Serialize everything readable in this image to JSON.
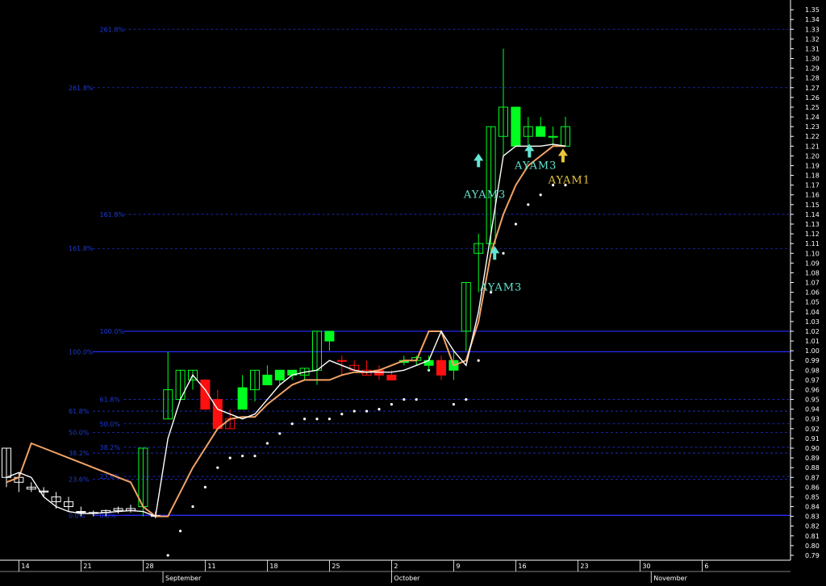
{
  "chart_data": {
    "type": "candlestick",
    "ylim": [
      0.785,
      1.36
    ],
    "y_ticks": [
      0.79,
      0.8,
      0.81,
      0.82,
      0.83,
      0.84,
      0.85,
      0.86,
      0.87,
      0.88,
      0.89,
      0.9,
      0.91,
      0.92,
      0.93,
      0.94,
      0.95,
      0.96,
      0.97,
      0.98,
      0.99,
      1.0,
      1.01,
      1.02,
      1.03,
      1.04,
      1.05,
      1.06,
      1.07,
      1.08,
      1.09,
      1.1,
      1.11,
      1.12,
      1.13,
      1.14,
      1.15,
      1.16,
      1.17,
      1.18,
      1.19,
      1.2,
      1.21,
      1.22,
      1.23,
      1.24,
      1.25,
      1.26,
      1.27,
      1.28,
      1.29,
      1.3,
      1.31,
      1.32,
      1.33,
      1.34,
      1.35
    ],
    "x_day_labels": [
      {
        "i": 1,
        "label": "14"
      },
      {
        "i": 6,
        "label": "21"
      },
      {
        "i": 11,
        "label": "28"
      },
      {
        "i": 16,
        "label": "11"
      },
      {
        "i": 21,
        "label": "18"
      },
      {
        "i": 26,
        "label": "25"
      },
      {
        "i": 31,
        "label": "2"
      },
      {
        "i": 36,
        "label": "9"
      },
      {
        "i": 41,
        "label": "16"
      },
      {
        "i": 46,
        "label": "23"
      },
      {
        "i": 51,
        "label": "30"
      },
      {
        "i": 56,
        "label": "6"
      }
    ],
    "x_month_labels": [
      {
        "i": 12.6,
        "label": "September"
      },
      {
        "i": 31,
        "label": "October"
      },
      {
        "i": 51.9,
        "label": "November"
      }
    ],
    "candles": [
      {
        "o": 0.87,
        "h": 0.9,
        "l": 0.86,
        "c": 0.9
      },
      {
        "o": 0.865,
        "h": 0.875,
        "l": 0.855,
        "c": 0.87
      },
      {
        "o": 0.86,
        "h": 0.865,
        "l": 0.855,
        "c": 0.858
      },
      {
        "o": 0.855,
        "h": 0.86,
        "l": 0.85,
        "c": 0.856
      },
      {
        "o": 0.85,
        "h": 0.855,
        "l": 0.838,
        "c": 0.845
      },
      {
        "o": 0.845,
        "h": 0.85,
        "l": 0.835,
        "c": 0.84
      },
      {
        "o": 0.835,
        "h": 0.84,
        "l": 0.83,
        "c": 0.835
      },
      {
        "o": 0.833,
        "h": 0.836,
        "l": 0.83,
        "c": 0.834
      },
      {
        "o": 0.834,
        "h": 0.837,
        "l": 0.83,
        "c": 0.836
      },
      {
        "o": 0.836,
        "h": 0.84,
        "l": 0.833,
        "c": 0.838
      },
      {
        "o": 0.838,
        "h": 0.842,
        "l": 0.834,
        "c": 0.836
      },
      {
        "o": 0.84,
        "h": 0.9,
        "l": 0.83,
        "c": 0.9
      },
      {
        "o": 0.83,
        "h": 0.835,
        "l": 0.828,
        "c": 0.831
      },
      {
        "o": 0.93,
        "h": 0.999,
        "l": 0.93,
        "c": 0.96
      },
      {
        "o": 0.95,
        "h": 0.98,
        "l": 0.95,
        "c": 0.98
      },
      {
        "o": 0.97,
        "h": 0.98,
        "l": 0.96,
        "c": 0.98
      },
      {
        "o": 0.97,
        "h": 0.97,
        "l": 0.94,
        "c": 0.94
      },
      {
        "o": 0.95,
        "h": 0.96,
        "l": 0.92,
        "c": 0.92
      },
      {
        "o": 0.93,
        "h": 0.94,
        "l": 0.92,
        "c": 0.92
      },
      {
        "o": 0.962,
        "h": 0.975,
        "l": 0.94,
        "c": 0.94
      },
      {
        "o": 0.96,
        "h": 0.98,
        "l": 0.948,
        "c": 0.98
      },
      {
        "o": 0.975,
        "h": 0.985,
        "l": 0.965,
        "c": 0.965
      },
      {
        "o": 0.97,
        "h": 0.98,
        "l": 0.965,
        "c": 0.98
      },
      {
        "o": 0.975,
        "h": 0.98,
        "l": 0.97,
        "c": 0.98
      },
      {
        "o": 0.975,
        "h": 0.982,
        "l": 0.97,
        "c": 0.982
      },
      {
        "o": 0.98,
        "h": 1.02,
        "l": 0.965,
        "c": 1.02
      },
      {
        "o": 1.01,
        "h": 1.02,
        "l": 1.0,
        "c": 1.02
      },
      {
        "o": 0.99,
        "h": 0.995,
        "l": 0.975,
        "c": 0.99
      },
      {
        "o": 0.985,
        "h": 0.99,
        "l": 0.98,
        "c": 0.98
      },
      {
        "o": 0.98,
        "h": 0.99,
        "l": 0.975,
        "c": 0.975
      },
      {
        "o": 0.98,
        "h": 0.985,
        "l": 0.97,
        "c": 0.975
      },
      {
        "o": 0.97,
        "h": 0.98,
        "l": 0.97,
        "c": 0.975
      },
      {
        "o": 0.99,
        "h": 0.995,
        "l": 0.985,
        "c": 0.988
      },
      {
        "o": 0.99,
        "h": 0.995,
        "l": 0.985,
        "c": 0.993
      },
      {
        "o": 0.985,
        "h": 0.995,
        "l": 0.98,
        "c": 0.99
      },
      {
        "o": 0.99,
        "h": 0.995,
        "l": 0.97,
        "c": 0.975
      },
      {
        "o": 0.99,
        "h": 1.0,
        "l": 0.97,
        "c": 0.98
      },
      {
        "o": 1.02,
        "h": 1.07,
        "l": 1.0,
        "c": 1.07
      },
      {
        "o": 1.1,
        "h": 1.12,
        "l": 1.06,
        "c": 1.11
      },
      {
        "o": 1.11,
        "h": 1.23,
        "l": 1.1,
        "c": 1.23
      },
      {
        "o": 1.22,
        "h": 1.31,
        "l": 1.2,
        "c": 1.25
      },
      {
        "o": 1.25,
        "h": 1.25,
        "l": 1.21,
        "c": 1.21
      },
      {
        "o": 1.22,
        "h": 1.24,
        "l": 1.21,
        "c": 1.23
      },
      {
        "o": 1.23,
        "h": 1.24,
        "l": 1.22,
        "c": 1.22
      },
      {
        "o": 1.22,
        "h": 1.23,
        "l": 1.21,
        "c": 1.22
      },
      {
        "o": 1.21,
        "h": 1.24,
        "l": 1.21,
        "c": 1.23
      }
    ],
    "candle_colors": [
      "#ffffff",
      "#ffffff",
      "#ffffff",
      "#ffffff",
      "#ffffff",
      "#ffffff",
      "#ffffff",
      "#ffffff",
      "#ffffff",
      "#ffffff",
      "#ffffff",
      "#00ff20",
      "#ffffff",
      "#00ff20",
      "#00ff20",
      "#00ff20",
      "#ff1010",
      "#ff1010",
      "#ff1010",
      "#00ff20",
      "#00ff20",
      "#00ff20",
      "#00ff20",
      "#00ff20",
      "#00ff20",
      "#00ff20",
      "#00ff20",
      "#ff1010",
      "#ff1010",
      "#ff1010",
      "#ff1010",
      "#ff1010",
      "#00ff20",
      "#00ff20",
      "#00ff20",
      "#ff1010",
      "#00ff20",
      "#00ff20",
      "#00ff20",
      "#00ff20",
      "#00ff20",
      "#00ff20",
      "#00ff20",
      "#00ff20",
      "#00ff20",
      "#00ff20"
    ],
    "candle_fill": [
      false,
      false,
      false,
      false,
      false,
      false,
      false,
      false,
      false,
      false,
      false,
      false,
      false,
      false,
      false,
      false,
      true,
      true,
      false,
      true,
      false,
      true,
      true,
      true,
      false,
      false,
      true,
      false,
      false,
      false,
      true,
      true,
      true,
      false,
      true,
      true,
      true,
      false,
      false,
      false,
      false,
      true,
      false,
      true,
      true,
      false
    ],
    "fast_line": [
      0.87,
      0.875,
      0.87,
      0.85,
      0.84,
      0.835,
      0.833,
      0.833,
      0.834,
      0.835,
      0.836,
      0.835,
      0.83,
      0.91,
      0.95,
      0.975,
      0.96,
      0.94,
      0.935,
      0.93,
      0.935,
      0.95,
      0.965,
      0.975,
      0.978,
      0.98,
      0.99,
      0.985,
      0.98,
      0.978,
      0.978,
      0.978,
      0.98,
      0.985,
      0.99,
      1.02,
      1.0,
      0.985,
      1.04,
      1.12,
      1.2,
      1.21,
      1.21,
      1.21,
      1.212,
      1.21
    ],
    "slow_line": [
      0.865,
      0.87,
      0.905,
      0.9,
      0.895,
      0.89,
      0.885,
      0.88,
      0.875,
      0.87,
      0.865,
      0.84,
      0.83,
      0.83,
      0.855,
      0.88,
      0.9,
      0.92,
      0.93,
      0.932,
      0.932,
      0.945,
      0.955,
      0.965,
      0.97,
      0.97,
      0.97,
      0.975,
      0.978,
      0.978,
      0.98,
      0.985,
      0.99,
      0.99,
      1.02,
      1.02,
      0.985,
      0.99,
      1.03,
      1.1,
      1.14,
      1.17,
      1.19,
      1.2,
      1.21,
      1.21
    ],
    "fib_labels": [
      {
        "label": "261.8%",
        "y": 1.33,
        "i0": 7.5
      },
      {
        "label": "261.8%",
        "y": 1.27,
        "i0": 5
      },
      {
        "label": "161.8%",
        "y": 1.14,
        "i0": 7.5
      },
      {
        "label": "161.8%",
        "y": 1.105,
        "i0": 5
      },
      {
        "label": "100.0%",
        "y": 1.02,
        "i0": 7.5
      },
      {
        "label": "100.0%",
        "y": 0.999,
        "i0": 5
      },
      {
        "label": "61.8%",
        "y": 0.95,
        "i0": 7.5
      },
      {
        "label": "61.8%",
        "y": 0.938,
        "i0": 5
      },
      {
        "label": "50.0%",
        "y": 0.925,
        "i0": 7.5
      },
      {
        "label": "50.0%",
        "y": 0.916,
        "i0": 5
      },
      {
        "label": "38.2%",
        "y": 0.901,
        "i0": 7.5
      },
      {
        "label": "38.2%",
        "y": 0.895,
        "i0": 5
      },
      {
        "label": "23.6%",
        "y": 0.871,
        "i0": 7.5
      },
      {
        "label": "23.6%",
        "y": 0.868,
        "i0": 5
      },
      {
        "label": "0.0%",
        "y": 0.831,
        "i0": 7.5
      },
      {
        "label": "0.0%",
        "y": 0.831,
        "i0": 5
      }
    ],
    "signals": [
      {
        "label": "AYAM3",
        "i": 38.5,
        "y": 1.065,
        "arrow_y": 1.1,
        "color": "#62e6d2"
      },
      {
        "label": "AYAM3",
        "i": 37.2,
        "y": 1.16,
        "arrow_y": 1.195,
        "color": "#62e6d2"
      },
      {
        "label": "AYAM3",
        "i": 41.3,
        "y": 1.19,
        "arrow_y": 1.205,
        "color": "#62e6d2"
      },
      {
        "label": "AYAM1",
        "i": 44.0,
        "y": 1.175,
        "arrow_y": 1.2,
        "color": "#e8c53a"
      }
    ]
  }
}
